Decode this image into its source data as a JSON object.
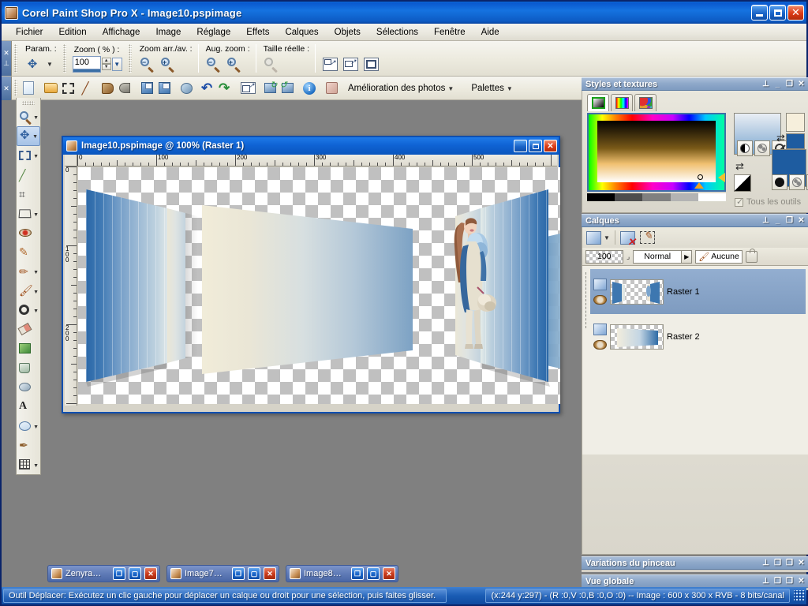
{
  "app": {
    "title": "Corel Paint Shop Pro X - Image10.pspimage",
    "icon": "app-icon",
    "window_buttons": {
      "minimize": "_",
      "maximize": "❐",
      "close": "✕"
    }
  },
  "menubar": {
    "items": [
      {
        "label": "Fichier"
      },
      {
        "label": "Edition"
      },
      {
        "label": "Affichage"
      },
      {
        "label": "Image"
      },
      {
        "label": "Réglage"
      },
      {
        "label": "Effets"
      },
      {
        "label": "Calques"
      },
      {
        "label": "Objets"
      },
      {
        "label": "Sélections"
      },
      {
        "label": "Fenêtre"
      },
      {
        "label": "Aide"
      }
    ]
  },
  "options_toolbar": {
    "groups": [
      {
        "label": "Param. :",
        "name": "parametres"
      },
      {
        "label": "Zoom ( % ) :",
        "name": "zoom-percent",
        "value": "100"
      },
      {
        "label": "Zoom arr./av. :",
        "name": "zoom-out-in"
      },
      {
        "label": "Aug. zoom :",
        "name": "augmenter-zoom"
      },
      {
        "label": "Taille réelle :",
        "name": "taille-reelle"
      }
    ],
    "spin_up": "▲",
    "spin_down": "▼",
    "dropdown": "▼"
  },
  "standard_toolbar": {
    "buttons": [
      {
        "name": "new-icon",
        "glyph": ""
      },
      {
        "name": "open-folder-icon",
        "glyph": ""
      },
      {
        "name": "browse-icon",
        "glyph": ""
      },
      {
        "name": "capture-icon",
        "glyph": ""
      },
      {
        "name": "print-layout-icon",
        "glyph": ""
      },
      {
        "name": "print-icon",
        "glyph": ""
      },
      {
        "name": "save-icon",
        "glyph": ""
      },
      {
        "name": "save-as-icon",
        "glyph": ""
      },
      {
        "name": "share-icon",
        "glyph": ""
      },
      {
        "name": "undo-icon",
        "glyph": "↶"
      },
      {
        "name": "redo-icon",
        "glyph": "↷"
      },
      {
        "name": "resize-icon",
        "glyph": ""
      },
      {
        "name": "rotate-left-icon",
        "glyph": ""
      },
      {
        "name": "rotate-right-icon",
        "glyph": ""
      },
      {
        "name": "info-icon",
        "glyph": "i"
      },
      {
        "name": "materials-icon",
        "glyph": ""
      }
    ],
    "photo_menu": "Amélioration des photos",
    "palettes_menu": "Palettes",
    "overflow": "»"
  },
  "tools_palette": {
    "tools": [
      {
        "name": "pan-zoom-tool",
        "glyph": "🔍",
        "submenu": true,
        "active": false
      },
      {
        "name": "move-tool",
        "glyph": "✥",
        "submenu": true,
        "active": true
      },
      {
        "name": "selection-tool",
        "glyph": "⬚",
        "submenu": true,
        "active": false
      },
      {
        "name": "dropper-tool",
        "glyph": "╱",
        "submenu": false,
        "active": false
      },
      {
        "name": "crop-tool",
        "glyph": "⌗",
        "submenu": false,
        "active": false
      },
      {
        "name": "deform-tool",
        "glyph": "▱",
        "submenu": true,
        "active": false
      },
      {
        "name": "red-eye-tool",
        "glyph": "◉",
        "submenu": false,
        "active": false
      },
      {
        "name": "makeover-tool",
        "glyph": "✎",
        "submenu": false,
        "active": false
      },
      {
        "name": "clone-brush-tool",
        "glyph": "✏",
        "submenu": true,
        "active": false
      },
      {
        "name": "paint-brush-tool",
        "glyph": "🖌",
        "submenu": true,
        "active": false
      },
      {
        "name": "lighten-darken-tool",
        "glyph": "◯",
        "submenu": true,
        "active": false
      },
      {
        "name": "eraser-tool",
        "glyph": "◧",
        "submenu": false,
        "active": false
      },
      {
        "name": "picture-tube-tool",
        "glyph": "❉",
        "submenu": false,
        "active": false
      },
      {
        "name": "flood-fill-tool",
        "glyph": "▣",
        "submenu": false,
        "active": false
      },
      {
        "name": "smudge-tool",
        "glyph": "◔",
        "submenu": false,
        "active": false
      },
      {
        "name": "text-tool",
        "glyph": "A",
        "submenu": false,
        "active": false
      },
      {
        "name": "preset-shape-tool",
        "glyph": "◠",
        "submenu": true,
        "active": false
      },
      {
        "name": "pen-tool",
        "glyph": "✒",
        "submenu": false,
        "active": false
      },
      {
        "name": "warp-brush-tool",
        "glyph": "▦",
        "submenu": true,
        "active": false
      }
    ]
  },
  "document_window": {
    "title": "Image10.pspimage @ 100% (Raster 1)",
    "icon": "document-icon",
    "buttons": {
      "minimize": "_",
      "maximize": "❐",
      "close": "✕"
    },
    "ruler_h_labels": [
      "0",
      "100",
      "200",
      "300",
      "400",
      "500"
    ],
    "ruler_v_labels": [
      "0",
      "100",
      "200"
    ]
  },
  "styles_panel": {
    "title": "Styles et textures",
    "buttons": {
      "pin": "⊥",
      "minimize": "_",
      "maximize": "❐",
      "close": "✕"
    },
    "tabs": [
      {
        "name": "frame-tab",
        "active": true
      },
      {
        "name": "rainbow-tab",
        "active": false
      },
      {
        "name": "swatches-tab",
        "active": false
      }
    ],
    "all_tools_label": "Tous les outils",
    "foreground_color": "#f6efdc",
    "background_color": "#1e5ca0",
    "gradient_color": "#2a6bb0"
  },
  "layers_panel": {
    "title": "Calques",
    "buttons": {
      "pin": "⊥",
      "minimize": "_",
      "maximize": "❐",
      "close": "✕"
    },
    "toolbar": [
      {
        "name": "new-layer-icon"
      },
      {
        "name": "delete-layer-icon"
      },
      {
        "name": "layer-properties-icon"
      }
    ],
    "opacity": "100",
    "blend_mode": "Normal",
    "blend_arrow": "▶",
    "link_label": "Aucune",
    "lock_icon": "lock-icon",
    "layers": [
      {
        "name": "Raster 1",
        "selected": true
      },
      {
        "name": "Raster 2",
        "selected": false
      }
    ]
  },
  "brush_panel": {
    "title": "Variations du pinceau",
    "buttons": {
      "pin": "⊥",
      "restore": "❐",
      "maximize": "❐",
      "close": "✕"
    }
  },
  "overview_panel": {
    "title": "Vue globale",
    "buttons": {
      "pin": "⊥",
      "restore": "❐",
      "maximize": "❐",
      "close": "✕"
    }
  },
  "document_taskbar": {
    "items": [
      {
        "label": "Zenyra…",
        "restore": "❐",
        "maximize": "❐",
        "close": "✕"
      },
      {
        "label": "Image7…",
        "restore": "❐",
        "maximize": "❐",
        "close": "✕"
      },
      {
        "label": "Image8…",
        "restore": "❐",
        "maximize": "❐",
        "close": "✕"
      }
    ]
  },
  "statusbar": {
    "hint": "Outil Déplacer: Exécutez un clic gauche pour déplacer un calque ou droit pour une sélection, puis faites glisser.",
    "position_info": "(x:244 y:297) - (R :0,V :0,B :0,O :0) -- Image :  600 x 300 x RVB - 8 bits/canal"
  },
  "colors": {
    "titlebar_blue": "#0f5ec4",
    "panel_header": "#8fa9ca",
    "accent": "#1e5ca0",
    "desktop_gray": "#808080",
    "status_blue": "#1a5cb4"
  }
}
